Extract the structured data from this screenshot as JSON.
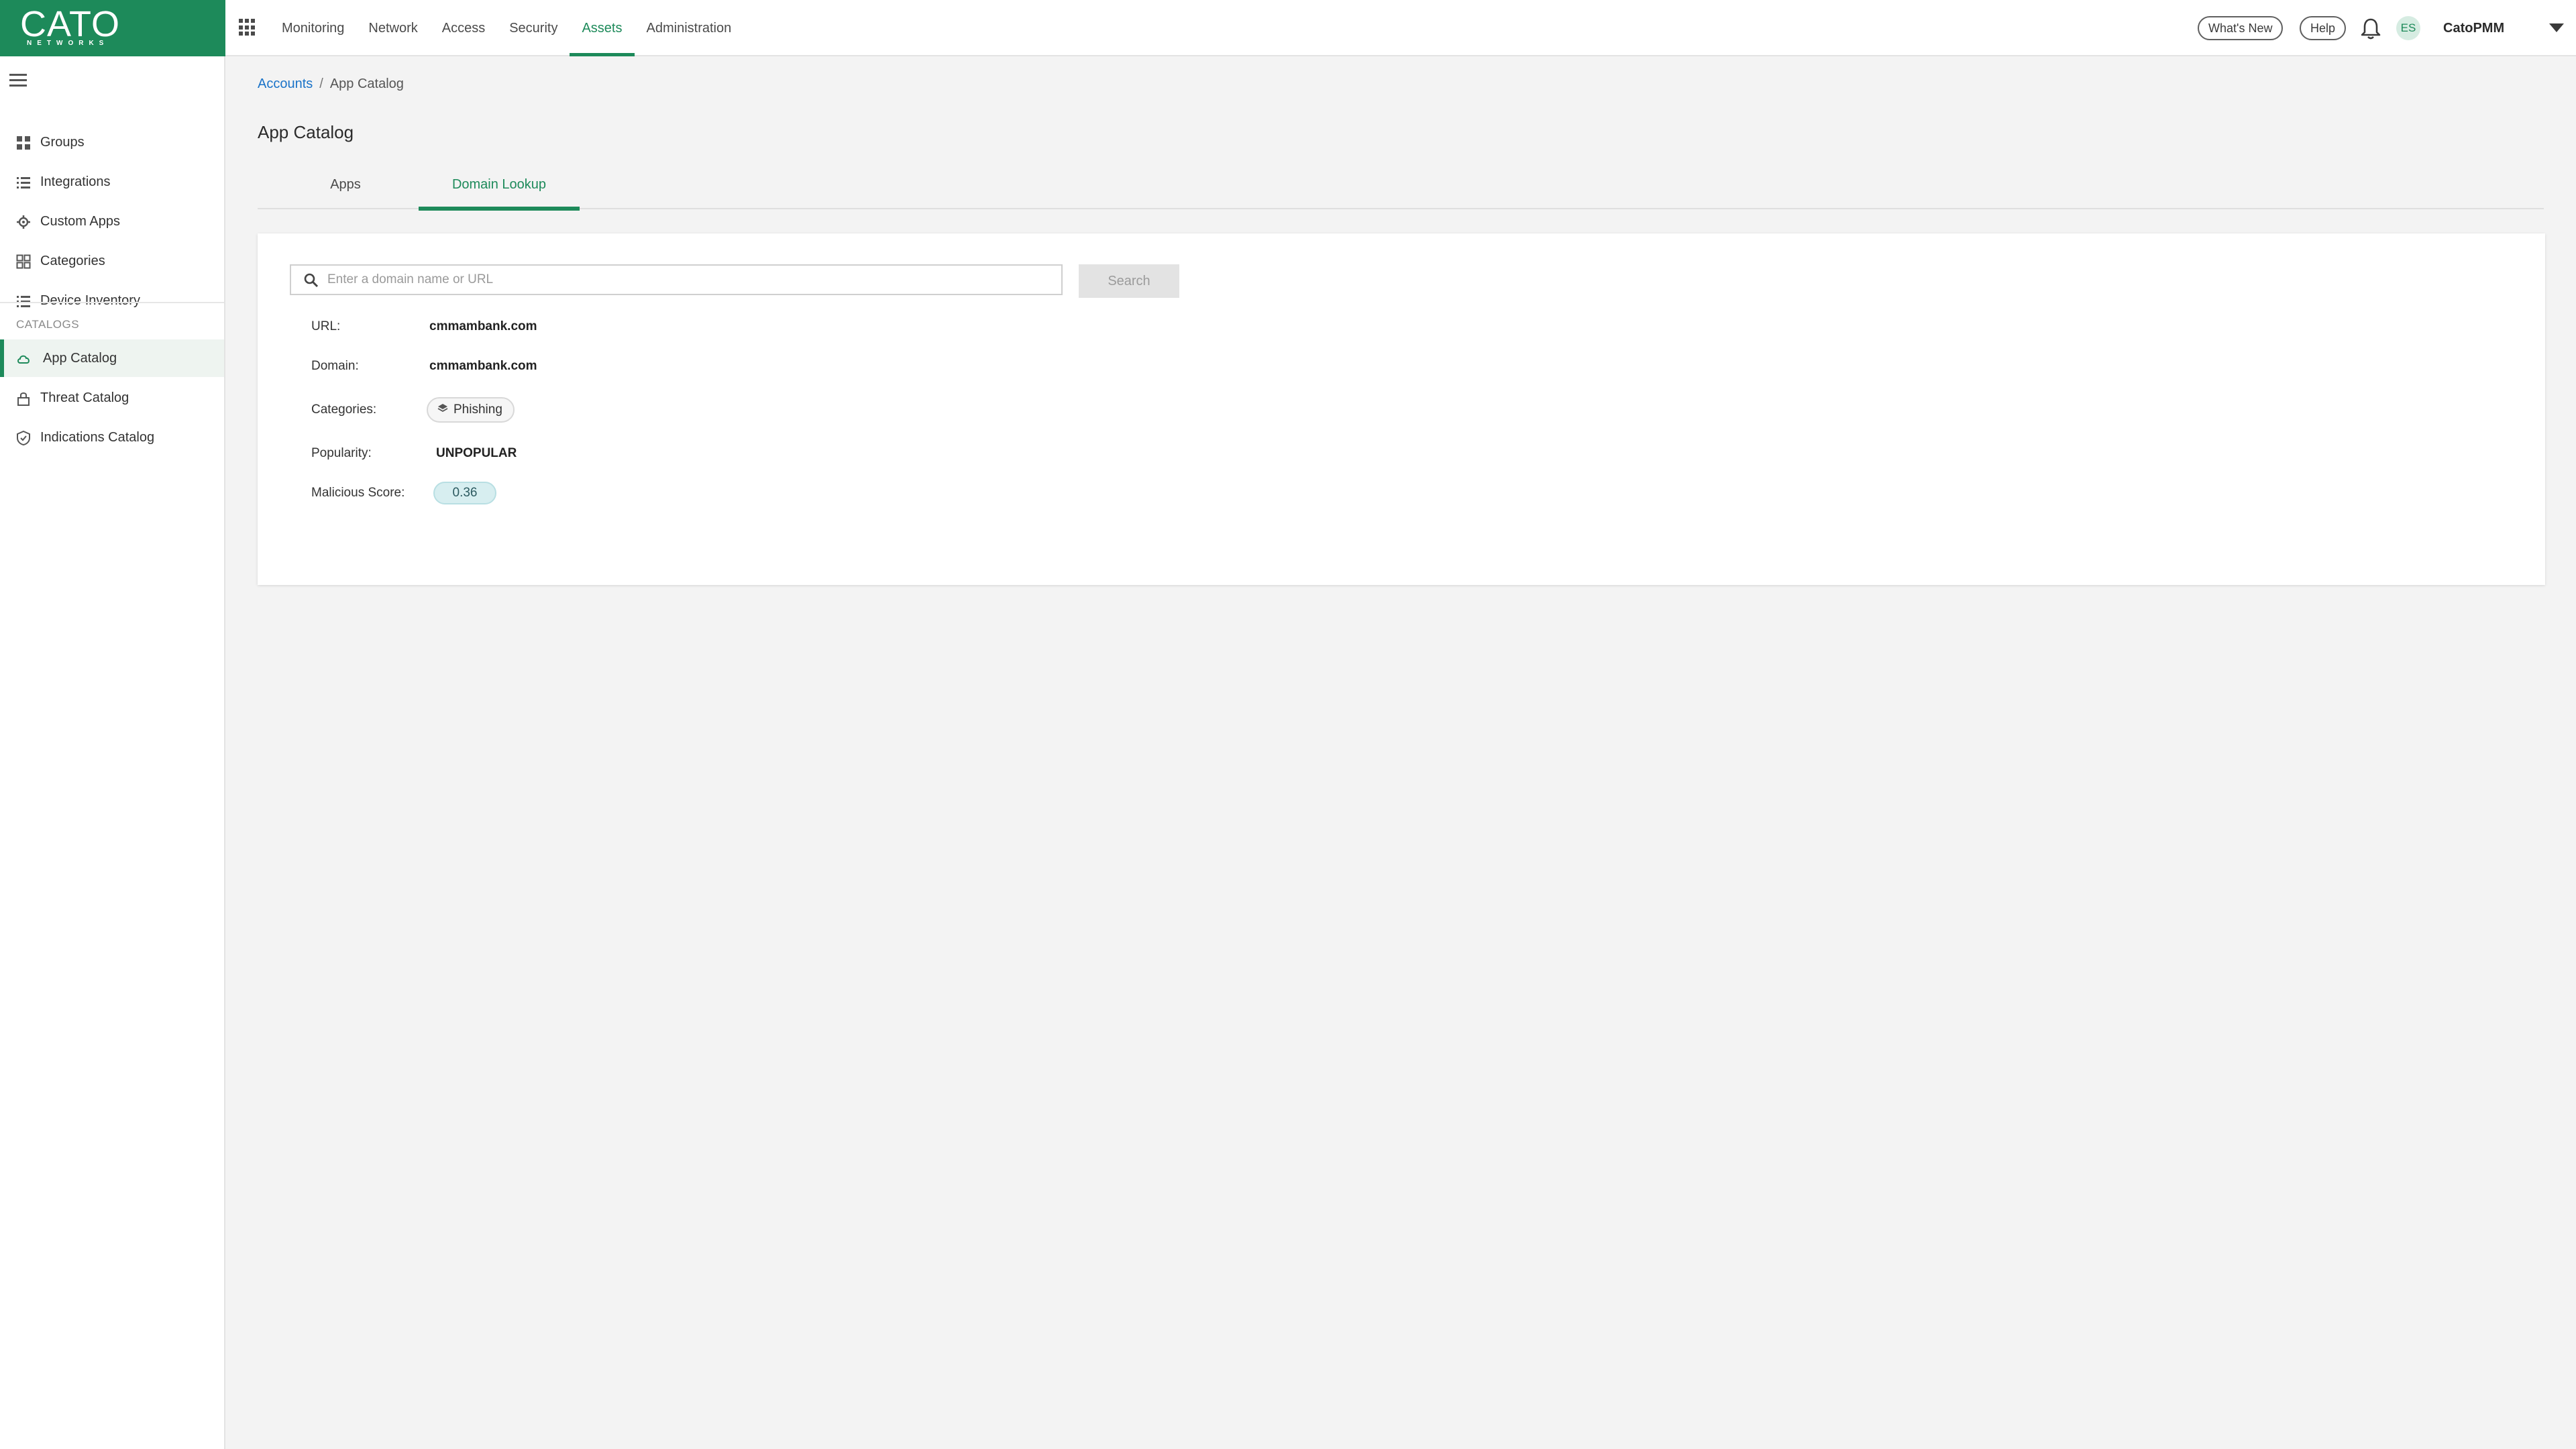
{
  "brand": {
    "name": "CATO",
    "tagline": "NETWORKS",
    "color": "#1d8a5a"
  },
  "topnav": {
    "items": [
      {
        "label": "Monitoring"
      },
      {
        "label": "Network"
      },
      {
        "label": "Access"
      },
      {
        "label": "Security"
      },
      {
        "label": "Assets",
        "active": true
      },
      {
        "label": "Administration"
      }
    ]
  },
  "header_right": {
    "whats_new": "What's New",
    "help": "Help",
    "avatar_initials": "ES",
    "account_name": "CatoPMM"
  },
  "sidebar": {
    "items": [
      {
        "label": "Groups",
        "icon": "grid-icon"
      },
      {
        "label": "Integrations",
        "icon": "list-icon"
      },
      {
        "label": "Custom Apps",
        "icon": "gear-icon"
      },
      {
        "label": "Categories",
        "icon": "categories-icon"
      },
      {
        "label": "Device Inventory",
        "icon": "list-icon"
      }
    ],
    "section_label": "CATALOGS",
    "catalog_items": [
      {
        "label": "App Catalog",
        "icon": "cloud-icon",
        "active": true
      },
      {
        "label": "Threat Catalog",
        "icon": "lock-icon"
      },
      {
        "label": "Indications Catalog",
        "icon": "shield-check-icon"
      }
    ]
  },
  "breadcrumb": {
    "root": "Accounts",
    "separator": "/",
    "current": "App Catalog"
  },
  "page": {
    "title": "App Catalog"
  },
  "tabs": [
    {
      "label": "Apps"
    },
    {
      "label": "Domain Lookup",
      "active": true
    }
  ],
  "lookup": {
    "search_placeholder": "Enter a domain name or URL",
    "search_value": "",
    "search_button": "Search",
    "fields": {
      "url_label": "URL:",
      "url_value": "cmmambank.com",
      "domain_label": "Domain:",
      "domain_value": "cmmambank.com",
      "categories_label": "Categories:",
      "category_value": "Phishing",
      "popularity_label": "Popularity:",
      "popularity_value": "UNPOPULAR",
      "malicious_label": "Malicious Score:",
      "malicious_value": "0.36"
    }
  },
  "colors": {
    "accent": "#1d8a5a",
    "link": "#1a73c8",
    "background": "#f3f3f3",
    "score_badge": "#d7eef0"
  }
}
